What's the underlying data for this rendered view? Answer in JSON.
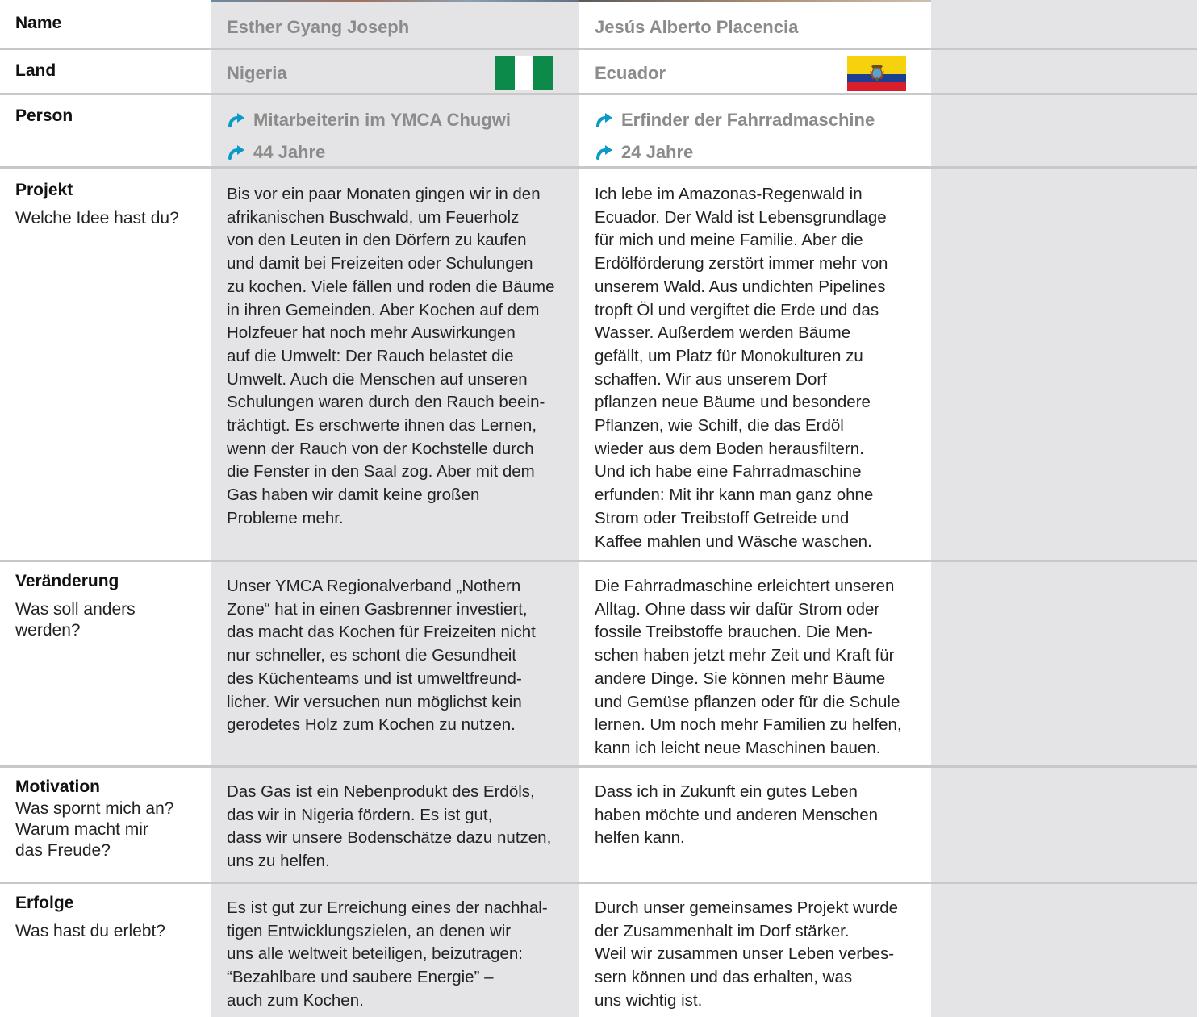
{
  "colors": {
    "accent": "#0a9ac8",
    "shade": "#e4e4e6",
    "grey_text": "#8b8b8b",
    "rule": "#c8c8c8"
  },
  "rows": {
    "name": {
      "label": "Name"
    },
    "land": {
      "label": "Land"
    },
    "person": {
      "label": "Person"
    },
    "projekt": {
      "label": "Projekt",
      "question": "Welche Idee hast du?"
    },
    "veraenderung": {
      "label": "Veränderung",
      "question": [
        "Was soll anders",
        "werden?"
      ]
    },
    "motivation": {
      "label": "Motivation",
      "question": [
        "Was spornt mich an?",
        "Warum macht mir",
        "das Freude?"
      ]
    },
    "erfolge": {
      "label": "Erfolge",
      "question": "Was hast du erlebt?"
    }
  },
  "people": [
    {
      "name": "Esther Gyang Joseph",
      "country": "Nigeria",
      "flag_icon": "nigeria-flag-icon",
      "facts": [
        "Mitarbeiterin im YMCA Chugwi",
        "44 Jahre"
      ],
      "projekt": [
        "Bis vor ein paar Monaten gingen wir in den",
        "afrikanischen Buschwald, um Feuerholz",
        "von den Leuten in den Dörfern zu kaufen",
        "und damit bei Freizeiten oder Schulungen",
        "zu kochen. Viele fällen und roden die Bäume",
        "in ihren Gemeinden. Aber Kochen auf dem",
        "Holzfeuer hat noch mehr Auswirkungen",
        "auf die Umwelt: Der Rauch belastet die",
        "Umwelt. Auch die Menschen auf unseren",
        "Schulungen waren durch den Rauch beein-",
        "trächtigt. Es erschwerte ihnen das Lernen,",
        "wenn der Rauch von der Kochstelle durch",
        "die Fenster in den Saal zog. Aber mit dem",
        "Gas haben wir damit keine großen",
        "Probleme mehr."
      ],
      "veraenderung": [
        "Unser YMCA Regionalverband „Nothern",
        "Zone“ hat in einen Gasbrenner investiert,",
        "das macht das Kochen für Freizeiten nicht",
        "nur schneller, es schont die Gesundheit",
        "des Küchenteams und ist umweltfreund-",
        "licher. Wir versuchen nun möglichst kein",
        "gerodetes Holz zum Kochen zu nutzen."
      ],
      "motivation": [
        "Das Gas ist ein Nebenprodukt des Erdöls,",
        "das wir in Nigeria fördern. Es ist gut,",
        "dass wir unsere Bodenschätze dazu nutzen,",
        "uns zu helfen."
      ],
      "erfolge": [
        "Es ist gut zur Erreichung eines der nachhal-",
        "tigen Entwicklungszielen, an denen wir",
        "uns alle weltweit beteiligen, beizutragen:",
        "“Bezahlbare und saubere Energie” –",
        "auch zum Kochen."
      ]
    },
    {
      "name": "Jesús Alberto Placencia",
      "country": "Ecuador",
      "flag_icon": "ecuador-flag-icon",
      "facts": [
        "Erfinder der Fahrradmaschine",
        "24 Jahre"
      ],
      "projekt": [
        "Ich lebe im Amazonas-Regenwald in",
        "Ecuador. Der Wald ist Lebensgrundlage",
        "für mich und meine Familie. Aber die",
        "Erdölförderung zerstört immer mehr von",
        "unserem Wald. Aus undichten Pipelines",
        "tropft Öl und vergiftet die Erde und das",
        "Wasser. Außerdem werden Bäume",
        "gefällt, um Platz für Monokulturen zu",
        "schaffen. Wir aus unserem Dorf",
        "pflanzen neue Bäume und besondere",
        "Pflanzen, wie Schilf, die das Erdöl",
        "wieder aus dem Boden herausfiltern.",
        "Und ich habe eine Fahrradmaschine",
        "erfunden: Mit ihr kann man ganz ohne",
        "Strom oder Treibstoff Getreide und",
        "Kaffee mahlen und Wäsche waschen."
      ],
      "veraenderung": [
        "Die Fahrradmaschine erleichtert unseren",
        "Alltag. Ohne dass wir dafür Strom oder",
        "fossile Treibstoffe brauchen. Die Men-",
        "schen haben jetzt mehr Zeit und Kraft für",
        "andere Dinge. Sie können mehr Bäume",
        "und Gemüse pflanzen oder für die Schule",
        "lernen. Um noch mehr Familien zu helfen,",
        "kann ich leicht neue Maschinen bauen."
      ],
      "motivation": [
        "Dass ich in Zukunft ein gutes Leben",
        "haben möchte und anderen Menschen",
        "helfen kann."
      ],
      "erfolge": [
        "Durch unser gemeinsames Projekt wurde",
        "der Zusammenhalt im Dorf stärker.",
        "Weil wir zusammen unser Leben verbes-",
        "sern können und das erhalten, was",
        "uns wichtig ist."
      ]
    }
  ]
}
